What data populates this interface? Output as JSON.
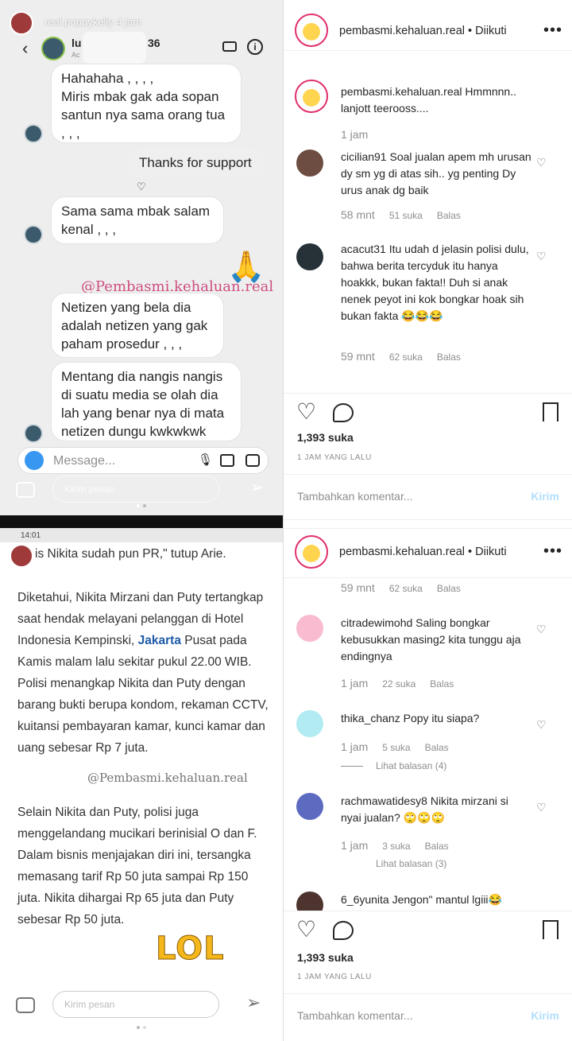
{
  "story1": {
    "username": "real.poppykelly",
    "time": "4 jam",
    "dm_name_prefix": "lu",
    "dm_name_suffix": "36",
    "dm_sub": "Ac",
    "bubbles": [
      "Hahahaha , , , ,\nMiris mbak gak ada sopan santun nya sama orang tua , , ,",
      "Thanks for support",
      "Sama sama mbak salam kenal , , ,",
      "Netizen yang bela dia adalah netizen yang gak paham prosedur , , ,",
      "Mentang dia nangis nangis di suatu media se olah dia lah yang benar nya di mata netizen dungu kwkwkwk"
    ],
    "watermark": "@Pembasmi.kehaluan.real",
    "emoji": "🙏",
    "message_placeholder": "Message...",
    "reply_placeholder": "Kirim pesan"
  },
  "story2": {
    "status_time": "14:01",
    "top_line": "is Nikita sudah pun PR,\" tutup Arie.",
    "para1_before": "Diketahui, Nikita Mirzani dan Puty tertangkap saat hendak melayani pelanggan di Hotel Indonesia Kempinski, ",
    "para1_link": "Jakarta",
    "para1_after": " Pusat pada Kamis malam lalu sekitar pukul 22.00 WIB. Polisi menangkap Nikita dan Puty dengan barang bukti berupa kondom, rekaman CCTV, kuitansi pembayaran kamar, kunci kamar dan uang sebesar Rp 7 juta.",
    "watermark": "@Pembasmi.kehaluan.real",
    "para2": "Selain Nikita dan Puty, polisi juga menggelandang mucikari berinisial O dan F. Dalam bisnis menjajakan diri ini, tersangka memasang tarif Rp 50 juta sampai Rp 150 juta. Nikita dihargai Rp 65 juta dan Puty sebesar Rp 50 juta.",
    "sticker": "LOL",
    "reply_placeholder": "Kirim pesan"
  },
  "post1": {
    "account": "pembasmi.kehaluan.real",
    "follow": "• Diikuti",
    "caption_user": "pembasmi.kehaluan.real",
    "caption": " Hmmnnn.. lanjott teerooss....",
    "caption_time": "1 jam",
    "comments": [
      {
        "user": "cicilian91",
        "text": " Soal jualan apem mh urusan dy sm yg di atas sih.. yg penting Dy urus anak dg baik",
        "time": "58 mnt",
        "likes": "51 suka",
        "reply": "Balas"
      },
      {
        "user": "acacut31",
        "text": " Itu udah d jelasin polisi dulu, bahwa berita tercyduk itu hanya hoakkk, bukan fakta!! Duh si anak nenek peyot ini kok bongkar hoak sih bukan fakta 😂😂😂",
        "time": "59 mnt",
        "likes": "62 suka",
        "reply": "Balas"
      }
    ],
    "likes": "1,393 suka",
    "ago": "1 JAM YANG LALU",
    "add_comment": "Tambahkan komentar...",
    "send": "Kirim"
  },
  "post2": {
    "account": "pembasmi.kehaluan.real",
    "follow": "• Diikuti",
    "partial_meta": {
      "time": "59 mnt",
      "likes": "62 suka",
      "reply": "Balas"
    },
    "comments": [
      {
        "user": "citradewimohd",
        "text": " Saling bongkar kebusukkan masing2 kita tunggu aja endingnya",
        "time": "1 jam",
        "likes": "22 suka",
        "reply": "Balas",
        "view_replies": ""
      },
      {
        "user": "thika_chanz",
        "text": " Popy itu siapa?",
        "time": "1 jam",
        "likes": "5 suka",
        "reply": "Balas",
        "view_replies": "Lihat balasan (4)"
      },
      {
        "user": "rachmawatidesy8",
        "text": " Nikita mirzani si nyai jualan? 🙄🙄🙄",
        "time": "1 jam",
        "likes": "3 suka",
        "reply": "Balas",
        "view_replies": "Lihat balasan (3)"
      },
      {
        "user": "6_6yunita",
        "text": " Jengon\" mantul lgiii😂",
        "time": "",
        "likes": "",
        "reply": "",
        "view_replies": ""
      }
    ],
    "likes": "1,393 suka",
    "ago": "1 JAM YANG LALU",
    "add_comment": "Tambahkan komentar...",
    "send": "Kirim"
  }
}
